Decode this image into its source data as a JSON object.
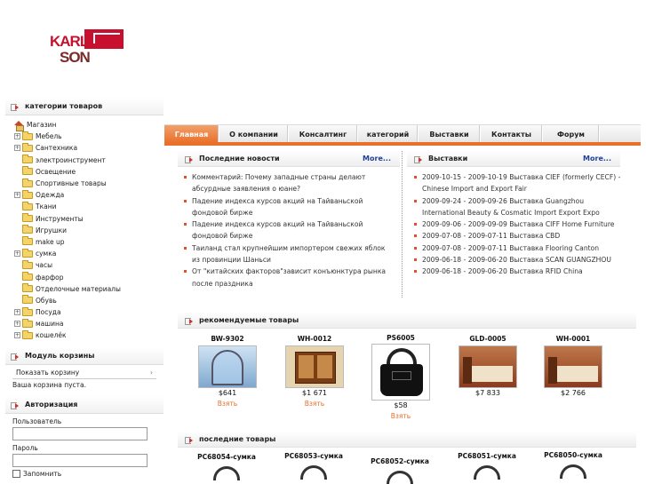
{
  "logo": {
    "line1": "KARL",
    "line2": "SON"
  },
  "sidebar": {
    "categories_title": "категории товаров",
    "root": "Магазин",
    "items": [
      {
        "label": "Мебель",
        "expandable": true
      },
      {
        "label": "Сантехника",
        "expandable": true
      },
      {
        "label": "электроинструмент",
        "expandable": false
      },
      {
        "label": "Освещение",
        "expandable": false
      },
      {
        "label": "Спортивные товары",
        "expandable": false
      },
      {
        "label": "Одежда",
        "expandable": true
      },
      {
        "label": "Ткани",
        "expandable": false
      },
      {
        "label": "Инструменты",
        "expandable": false
      },
      {
        "label": "Игрушки",
        "expandable": false
      },
      {
        "label": "make up",
        "expandable": false
      },
      {
        "label": "сумка",
        "expandable": true
      },
      {
        "label": "часы",
        "expandable": false
      },
      {
        "label": "фарфор",
        "expandable": false
      },
      {
        "label": "Отделочные материалы",
        "expandable": false
      },
      {
        "label": "Обувь",
        "expandable": false
      },
      {
        "label": "Посуда",
        "expandable": true
      },
      {
        "label": "машина",
        "expandable": true
      },
      {
        "label": "кошелёк",
        "expandable": true
      }
    ],
    "cart_title": "Модуль корзины",
    "cart_show": "Показать корзину",
    "cart_chevron": "›",
    "cart_empty": "Ваша корзина пуста.",
    "auth_title": "Авторизация",
    "login_label": "Пользователь",
    "password_label": "Пароль",
    "remember_label": "Запомнить"
  },
  "nav": {
    "items": [
      "Главная",
      "О компании",
      "Консалтинг",
      "категорий",
      "Выставки",
      "Контакты",
      "Форум"
    ],
    "active_index": 0
  },
  "news": {
    "title": "Последние новости",
    "more": "More...",
    "items": [
      "Комментарий: Почему западные страны делают абсурдные заявления о юане?",
      "Падение индекса курсов акций на Тайваньской фондовой бирже",
      "Падение индекса курсов акций на Тайваньской фондовой бирже",
      "Таиланд стал крупнейшим импортером свежих яблок из провинции Шаньси",
      "От \"китайских факторов\"зависит конъюнктура рынка после праздника"
    ]
  },
  "exhibitions": {
    "title": "Выставки",
    "more": "More...",
    "items": [
      "2009-10-15 - 2009-10-19 Выставка CIEF (formerly CECF) - Chinese Import and Export Fair",
      "2009-09-24 - 2009-09-26 Выставка Guangzhou International Beauty & Cosmatic Import Export Expo",
      "2009-09-06 - 2009-09-09 Выставка CIFF Home Furniture",
      "2009-07-08 - 2009-07-11 Выставка CBD",
      "2009-07-08 - 2009-07-11 Выставка Flooring Canton",
      "2009-06-18 - 2009-06-20 Выставка SCAN GUANGZHOU",
      "2009-06-18 - 2009-06-20 Выставка RFID China"
    ]
  },
  "recommended": {
    "title": "рекомендуемые товары",
    "take_label": "Взять",
    "products": [
      {
        "code": "BW-9302",
        "price": "$641",
        "image": "shower-cabin"
      },
      {
        "code": "WH-0012",
        "price": "$1 671",
        "image": "cabinet"
      },
      {
        "code": "PS6005",
        "price": "$58",
        "image": "handbag"
      },
      {
        "code": "GLD-0005",
        "price": "$7 833",
        "image": "bedroom-set"
      },
      {
        "code": "WH-0001",
        "price": "$2 766",
        "image": "bedroom-set"
      }
    ]
  },
  "latest": {
    "title": "последние товары",
    "products": [
      {
        "code": "PC68054-сумка"
      },
      {
        "code": "PC68053-сумка"
      },
      {
        "code": "PC68052-сумка"
      },
      {
        "code": "PC68051-сумка"
      },
      {
        "code": "PC68050-сумка"
      }
    ]
  },
  "colors": {
    "accent": "#e8702a",
    "link": "#1f3f9a",
    "brand": "#c8102e"
  }
}
